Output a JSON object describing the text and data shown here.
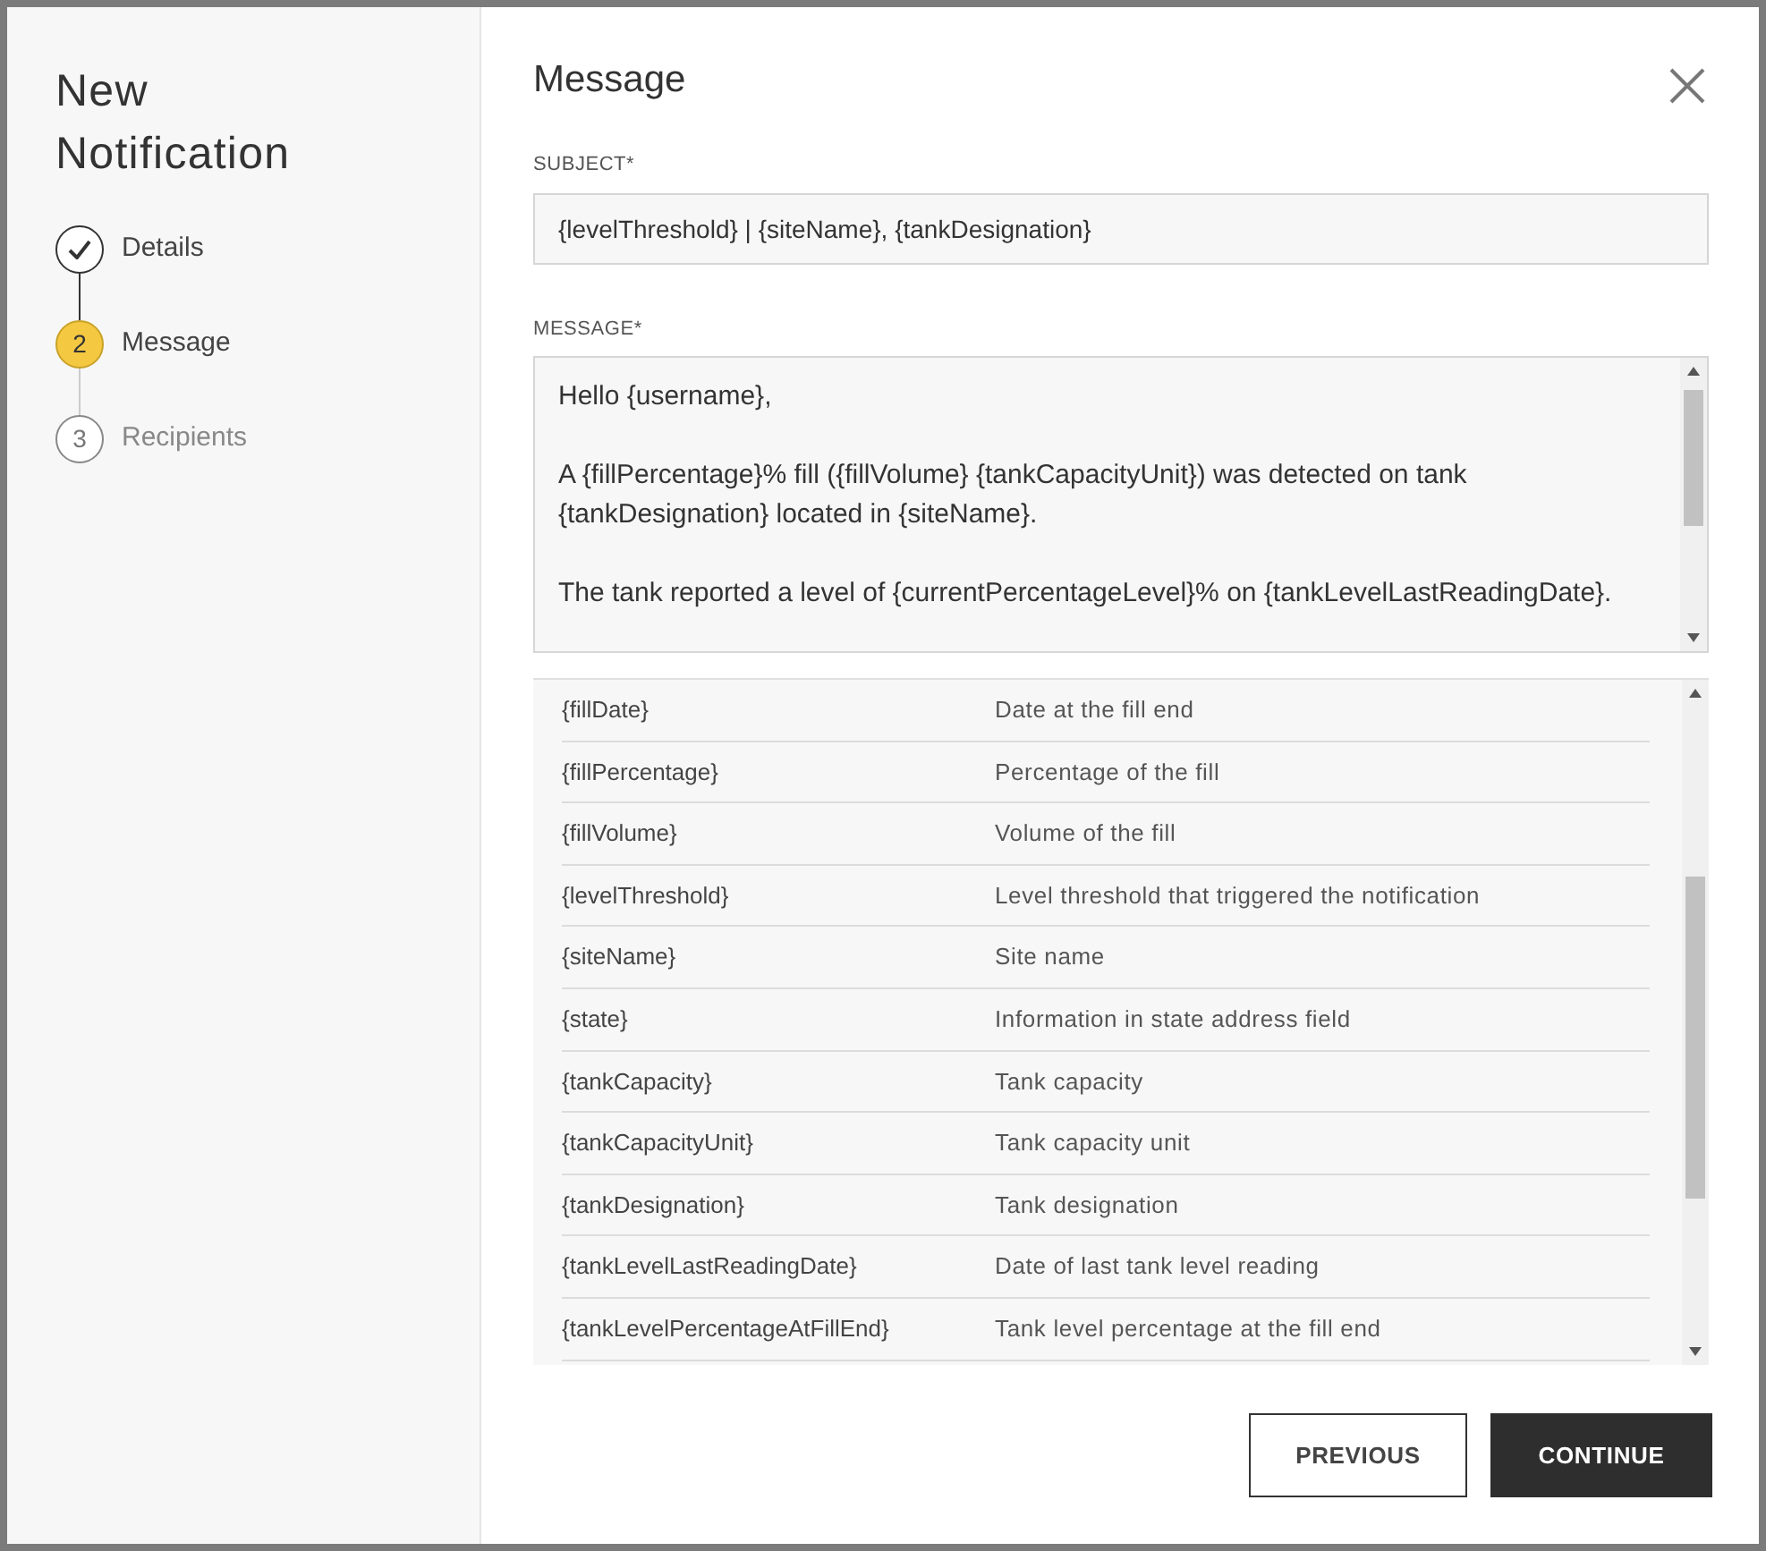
{
  "sidebar": {
    "title": "New Notification",
    "steps": [
      {
        "label": "Details",
        "done": true,
        "selected": false
      },
      {
        "number": "2",
        "label": "Message",
        "done": false,
        "selected": true
      },
      {
        "number": "3",
        "label": "Recipients",
        "done": false,
        "selected": false
      }
    ]
  },
  "main": {
    "title": "Message",
    "subject": {
      "label": "SUBJECT*",
      "value": "{levelThreshold} | {siteName}, {tankDesignation}"
    },
    "message": {
      "label": "MESSAGE*",
      "paragraphs": [
        "Hello {username},",
        "A {fillPercentage}% fill ({fillVolume} {tankCapacityUnit}) was detected on tank {tankDesignation} located in {siteName}.",
        "The tank reported a level of {currentPercentageLevel}% on {tankLevelLastReadingDate}."
      ]
    },
    "variables": [
      {
        "name": "{fillDate}",
        "description": "Date at the fill end"
      },
      {
        "name": "{fillPercentage}",
        "description": "Percentage of the fill"
      },
      {
        "name": "{fillVolume}",
        "description": "Volume of the fill"
      },
      {
        "name": "{levelThreshold}",
        "description": "Level threshold that triggered the notification"
      },
      {
        "name": "{siteName}",
        "description": "Site name"
      },
      {
        "name": "{state}",
        "description": "Information in state address field"
      },
      {
        "name": "{tankCapacity}",
        "description": "Tank capacity"
      },
      {
        "name": "{tankCapacityUnit}",
        "description": "Tank capacity unit"
      },
      {
        "name": "{tankDesignation}",
        "description": "Tank designation"
      },
      {
        "name": "{tankLevelLastReadingDate}",
        "description": "Date of last tank level reading"
      },
      {
        "name": "{tankLevelPercentageAtFillEnd}",
        "description": "Tank level percentage at the fill end"
      }
    ]
  },
  "buttons": {
    "previous": "PREVIOUS",
    "continue": "CONTINUE"
  }
}
